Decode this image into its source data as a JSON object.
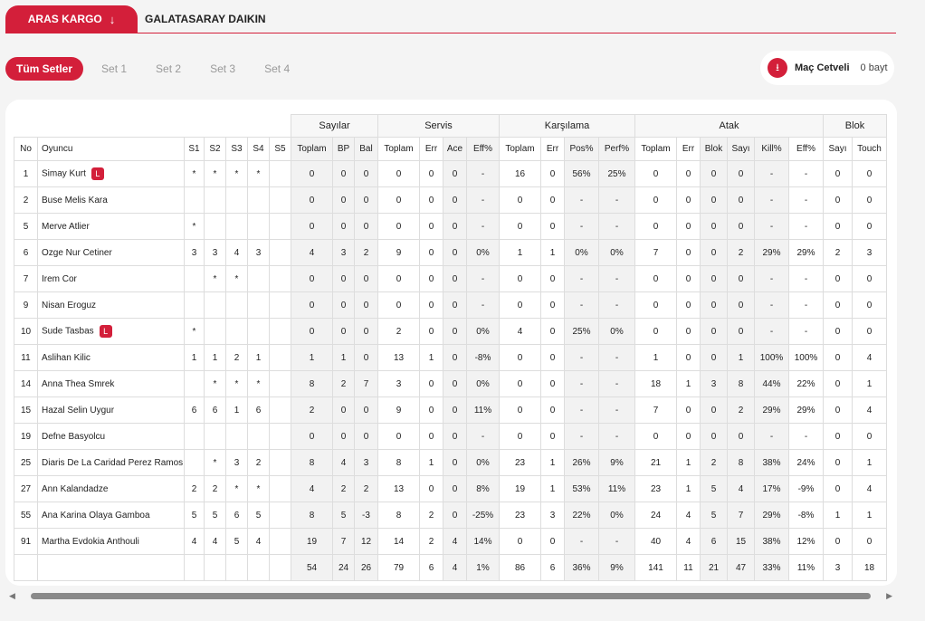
{
  "teams": {
    "active": "ARAS KARGO",
    "inactive": "GALATASARAY DAIKIN"
  },
  "sets": [
    "Tüm Setler",
    "Set 1",
    "Set 2",
    "Set 3",
    "Set 4"
  ],
  "download": {
    "label": "Maç Cetveli",
    "size": "0 bayt"
  },
  "groups": [
    "Sayılar",
    "Servis",
    "Karşılama",
    "Atak",
    "Blok"
  ],
  "columns": [
    "No",
    "Oyuncu",
    "S1",
    "S2",
    "S3",
    "S4",
    "S5",
    "Toplam",
    "BP",
    "Bal",
    "Toplam",
    "Err",
    "Ace",
    "Eff%",
    "Toplam",
    "Err",
    "Pos%",
    "Perf%",
    "Toplam",
    "Err",
    "Blok",
    "Sayı",
    "Kill%",
    "Eff%",
    "Sayı",
    "Touch"
  ],
  "players": [
    {
      "no": "1",
      "name": "Simay Kurt",
      "libero": "L",
      "sets": [
        "*",
        "*",
        "*",
        "*",
        ""
      ],
      "stats": [
        "0",
        "0",
        "0",
        "0",
        "0",
        "0",
        "-",
        "16",
        "0",
        "56%",
        "25%",
        "0",
        "0",
        "0",
        "0",
        "-",
        "-",
        "0",
        "0"
      ]
    },
    {
      "no": "2",
      "name": "Buse Melis Kara",
      "libero": "",
      "sets": [
        "",
        "",
        "",
        "",
        ""
      ],
      "stats": [
        "0",
        "0",
        "0",
        "0",
        "0",
        "0",
        "-",
        "0",
        "0",
        "-",
        "-",
        "0",
        "0",
        "0",
        "0",
        "-",
        "-",
        "0",
        "0"
      ]
    },
    {
      "no": "5",
      "name": "Merve Atlier",
      "libero": "",
      "sets": [
        "*",
        "",
        "",
        "",
        ""
      ],
      "stats": [
        "0",
        "0",
        "0",
        "0",
        "0",
        "0",
        "-",
        "0",
        "0",
        "-",
        "-",
        "0",
        "0",
        "0",
        "0",
        "-",
        "-",
        "0",
        "0"
      ]
    },
    {
      "no": "6",
      "name": "Ozge Nur Cetiner",
      "libero": "",
      "sets": [
        "3",
        "3",
        "4",
        "3",
        ""
      ],
      "stats": [
        "4",
        "3",
        "2",
        "9",
        "0",
        "0",
        "0%",
        "1",
        "1",
        "0%",
        "0%",
        "7",
        "0",
        "0",
        "2",
        "29%",
        "29%",
        "2",
        "3"
      ]
    },
    {
      "no": "7",
      "name": "Irem Cor",
      "libero": "",
      "sets": [
        "",
        "*",
        "*",
        "",
        ""
      ],
      "stats": [
        "0",
        "0",
        "0",
        "0",
        "0",
        "0",
        "-",
        "0",
        "0",
        "-",
        "-",
        "0",
        "0",
        "0",
        "0",
        "-",
        "-",
        "0",
        "0"
      ]
    },
    {
      "no": "9",
      "name": "Nisan Eroguz",
      "libero": "",
      "sets": [
        "",
        "",
        "",
        "",
        ""
      ],
      "stats": [
        "0",
        "0",
        "0",
        "0",
        "0",
        "0",
        "-",
        "0",
        "0",
        "-",
        "-",
        "0",
        "0",
        "0",
        "0",
        "-",
        "-",
        "0",
        "0"
      ]
    },
    {
      "no": "10",
      "name": "Sude Tasbas",
      "libero": "L",
      "sets": [
        "*",
        "",
        "",
        "",
        ""
      ],
      "stats": [
        "0",
        "0",
        "0",
        "2",
        "0",
        "0",
        "0%",
        "4",
        "0",
        "25%",
        "0%",
        "0",
        "0",
        "0",
        "0",
        "-",
        "-",
        "0",
        "0"
      ]
    },
    {
      "no": "11",
      "name": "Aslihan Kilic",
      "libero": "",
      "sets": [
        "1",
        "1",
        "2",
        "1",
        ""
      ],
      "stats": [
        "1",
        "1",
        "0",
        "13",
        "1",
        "0",
        "-8%",
        "0",
        "0",
        "-",
        "-",
        "1",
        "0",
        "0",
        "1",
        "100%",
        "100%",
        "0",
        "4"
      ]
    },
    {
      "no": "14",
      "name": "Anna Thea Smrek",
      "libero": "",
      "sets": [
        "",
        "*",
        "*",
        "*",
        ""
      ],
      "stats": [
        "8",
        "2",
        "7",
        "3",
        "0",
        "0",
        "0%",
        "0",
        "0",
        "-",
        "-",
        "18",
        "1",
        "3",
        "8",
        "44%",
        "22%",
        "0",
        "1"
      ]
    },
    {
      "no": "15",
      "name": "Hazal Selin Uygur",
      "libero": "",
      "sets": [
        "6",
        "6",
        "1",
        "6",
        ""
      ],
      "stats": [
        "2",
        "0",
        "0",
        "9",
        "0",
        "0",
        "11%",
        "0",
        "0",
        "-",
        "-",
        "7",
        "0",
        "0",
        "2",
        "29%",
        "29%",
        "0",
        "4"
      ]
    },
    {
      "no": "19",
      "name": "Defne Basyolcu",
      "libero": "",
      "sets": [
        "",
        "",
        "",
        "",
        ""
      ],
      "stats": [
        "0",
        "0",
        "0",
        "0",
        "0",
        "0",
        "-",
        "0",
        "0",
        "-",
        "-",
        "0",
        "0",
        "0",
        "0",
        "-",
        "-",
        "0",
        "0"
      ]
    },
    {
      "no": "25",
      "name": "Diaris De La Caridad Perez Ramos",
      "libero": "",
      "sets": [
        "",
        "*",
        "3",
        "2",
        ""
      ],
      "stats": [
        "8",
        "4",
        "3",
        "8",
        "1",
        "0",
        "0%",
        "23",
        "1",
        "26%",
        "9%",
        "21",
        "1",
        "2",
        "8",
        "38%",
        "24%",
        "0",
        "1"
      ]
    },
    {
      "no": "27",
      "name": "Ann Kalandadze",
      "libero": "",
      "sets": [
        "2",
        "2",
        "*",
        "*",
        ""
      ],
      "stats": [
        "4",
        "2",
        "2",
        "13",
        "0",
        "0",
        "8%",
        "19",
        "1",
        "53%",
        "11%",
        "23",
        "1",
        "5",
        "4",
        "17%",
        "-9%",
        "0",
        "4"
      ]
    },
    {
      "no": "55",
      "name": "Ana Karina Olaya Gamboa",
      "libero": "",
      "sets": [
        "5",
        "5",
        "6",
        "5",
        ""
      ],
      "stats": [
        "8",
        "5",
        "-3",
        "8",
        "2",
        "0",
        "-25%",
        "23",
        "3",
        "22%",
        "0%",
        "24",
        "4",
        "5",
        "7",
        "29%",
        "-8%",
        "1",
        "1"
      ]
    },
    {
      "no": "91",
      "name": "Martha Evdokia Anthouli",
      "libero": "",
      "sets": [
        "4",
        "4",
        "5",
        "4",
        ""
      ],
      "stats": [
        "19",
        "7",
        "12",
        "14",
        "2",
        "4",
        "14%",
        "0",
        "0",
        "-",
        "-",
        "40",
        "4",
        "6",
        "15",
        "38%",
        "12%",
        "0",
        "0"
      ]
    }
  ],
  "totals": [
    "54",
    "24",
    "26",
    "79",
    "6",
    "4",
    "1%",
    "86",
    "6",
    "36%",
    "9%",
    "141",
    "11",
    "21",
    "47",
    "33%",
    "11%",
    "3",
    "18"
  ],
  "colors": {
    "accent": "#d31f3a",
    "shade": "#f2f2f2"
  }
}
